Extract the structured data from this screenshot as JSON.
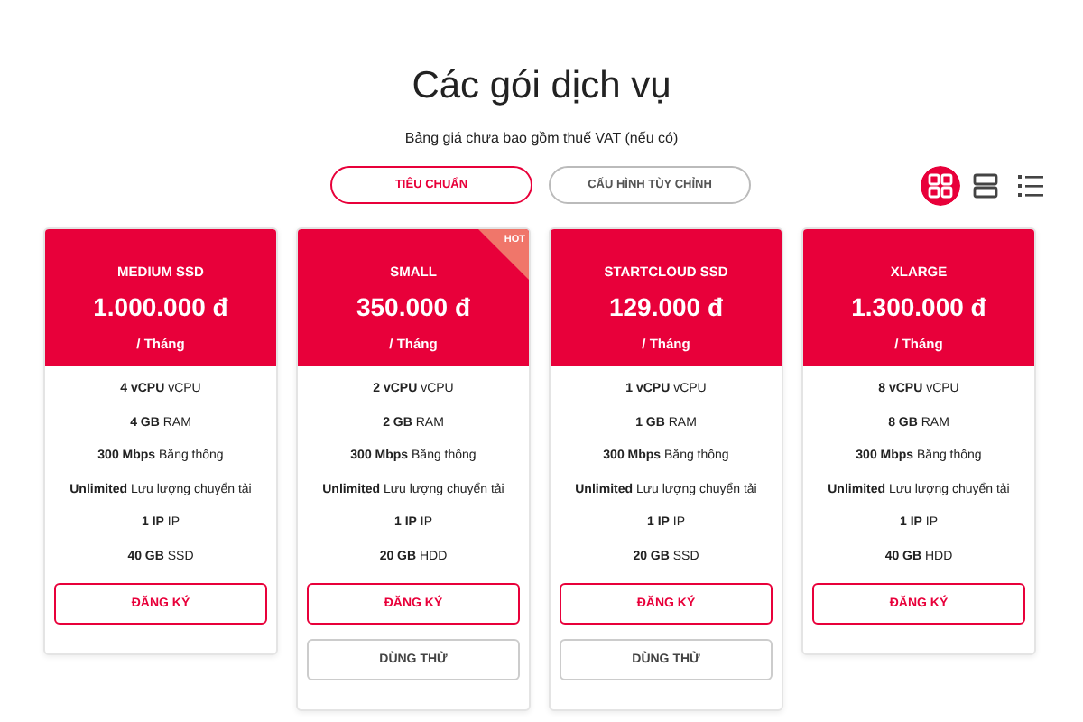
{
  "title": "Các gói dịch vụ",
  "subtitle": "Bảng giá chưa bao gồm thuế VAT (nếu có)",
  "tabs": [
    {
      "label": "TIÊU CHUẨN",
      "selected": true
    },
    {
      "label": "CẤU HÌNH TÙY CHỈNH",
      "selected": false
    }
  ],
  "view_modes": [
    {
      "kind": "grid",
      "selected": true
    },
    {
      "kind": "rows",
      "selected": false
    },
    {
      "kind": "list",
      "selected": false
    }
  ],
  "plans": [
    {
      "name": "MEDIUM SSD",
      "price": "1.000.000 đ",
      "period": "/ Tháng",
      "specs": [
        "**4 vCPU** vCPU",
        "**4 GB** RAM",
        "**300 Mbps** Băng thông",
        "**Unlimited** Lưu lượng chuyển tải",
        "**1 IP** IP",
        "**40 GB** SSD"
      ],
      "register": "ĐĂNG KÝ"
    },
    {
      "name": "SMALL",
      "price": "350.000 đ",
      "period": "/ Tháng",
      "badge": "HOT",
      "specs": [
        "**2 vCPU** vCPU",
        "**2 GB** RAM",
        "**300 Mbps** Băng thông",
        "**Unlimited** Lưu lượng chuyển tải",
        "**1 IP** IP",
        "**20 GB** HDD"
      ],
      "register": "ĐĂNG KÝ",
      "trial": "DÙNG THỬ"
    },
    {
      "name": "STARTCLOUD SSD",
      "price": "129.000 đ",
      "period": "/ Tháng",
      "specs": [
        "**1 vCPU** vCPU",
        "**1 GB** RAM",
        "**300 Mbps** Băng thông",
        "**Unlimited** Lưu lượng chuyển tải",
        "**1 IP** IP",
        "**20 GB** SSD"
      ],
      "register": "ĐĂNG KÝ",
      "trial": "DÙNG THỬ"
    },
    {
      "name": "XLARGE",
      "price": "1.300.000 đ",
      "period": "/ Tháng",
      "specs": [
        "**8 vCPU** vCPU",
        "**8 GB** RAM",
        "**300 Mbps** Băng thông",
        "**Unlimited** Lưu lượng chuyển tải",
        "**1 IP** IP",
        "**40 GB** HDD"
      ],
      "register": "ĐĂNG KÝ"
    }
  ]
}
